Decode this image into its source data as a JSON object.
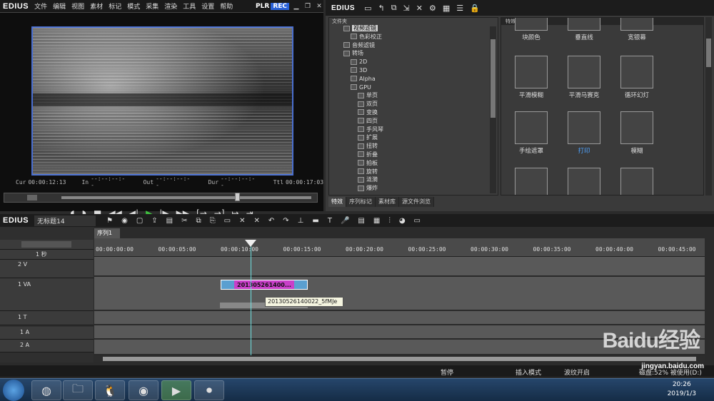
{
  "app": {
    "name": "EDIUS",
    "plr": "PLR",
    "rec": "REC"
  },
  "menu": [
    "文件",
    "编辑",
    "视图",
    "素材",
    "标记",
    "模式",
    "采集",
    "渲染",
    "工具",
    "设置",
    "帮助"
  ],
  "player": {
    "cur_label": "Cur",
    "cur": "00:00:12:13",
    "in_label": "In",
    "in": "--:--:--:--",
    "out_label": "Out",
    "out": "--:--:--:--",
    "dur_label": "Dur",
    "dur": "--:--:--:--",
    "ttl_label": "Ttl",
    "ttl": "00:00:17:03"
  },
  "bin": {
    "title": "EDIUS",
    "tree_header": "文件夹",
    "tree": [
      {
        "label": "视频滤镜",
        "indent": 2,
        "selected": true
      },
      {
        "label": "色彩校正",
        "indent": 3
      },
      {
        "label": "音频滤镜",
        "indent": 2
      },
      {
        "label": "转场",
        "indent": 2
      },
      {
        "label": "2D",
        "indent": 3
      },
      {
        "label": "3D",
        "indent": 3
      },
      {
        "label": "Alpha",
        "indent": 3
      },
      {
        "label": "GPU",
        "indent": 3
      },
      {
        "label": "单页",
        "indent": 4
      },
      {
        "label": "双页",
        "indent": 4
      },
      {
        "label": "变换",
        "indent": 4
      },
      {
        "label": "四页",
        "indent": 4
      },
      {
        "label": "手风琴",
        "indent": 4
      },
      {
        "label": "扩展",
        "indent": 4
      },
      {
        "label": "扭转",
        "indent": 4
      },
      {
        "label": "折叠",
        "indent": 4
      },
      {
        "label": "拍板",
        "indent": 4
      },
      {
        "label": "旋转",
        "indent": 4
      },
      {
        "label": "涟漪",
        "indent": 4
      },
      {
        "label": "爆炸",
        "indent": 4
      }
    ],
    "tabs": [
      "特效",
      "序列标记",
      "素材库",
      "源文件浏览"
    ],
    "fx_path": "特效\\视频滤镜",
    "effects": [
      {
        "label": "块颜色",
        "blue": false
      },
      {
        "label": "垂直线",
        "blue": false
      },
      {
        "label": "宽银幕",
        "blue": false
      },
      {
        "label": "平滑模糊",
        "blue": false
      },
      {
        "label": "平滑马赛克",
        "blue": false
      },
      {
        "label": "循环幻灯",
        "blue": false
      },
      {
        "label": "手绘遮罩",
        "blue": false
      },
      {
        "label": "打印",
        "blue": true
      },
      {
        "label": "模糊",
        "blue": false
      }
    ]
  },
  "timeline": {
    "logo": "EDIUS",
    "project": "无标题14",
    "seq_tab": "序列1",
    "zoom": "1 秒",
    "ruler": [
      "00:00:00:00",
      "00:00:05:00",
      "00:00:10:00",
      "00:00:15:00",
      "00:00:20:00",
      "00:00:25:00",
      "00:00:30:00",
      "00:00:35:00",
      "00:00:40:00",
      "00:00:45:00"
    ],
    "tracks": [
      "2 V",
      "1 VA",
      "1 T",
      "1 A",
      "2 A"
    ],
    "clip": "201305261400...",
    "tooltip": "20130526140022_5fMJe"
  },
  "status": {
    "pause": "暂停",
    "insert": "插入模式",
    "ripple": "波纹开启",
    "disk": "磁盘:52% 被使用(D:)"
  },
  "taskbar": {
    "time": "20:26",
    "date": "2019/1/3"
  },
  "watermark": {
    "brand": "Baidu经验",
    "url": "jingyan.baidu.com"
  }
}
